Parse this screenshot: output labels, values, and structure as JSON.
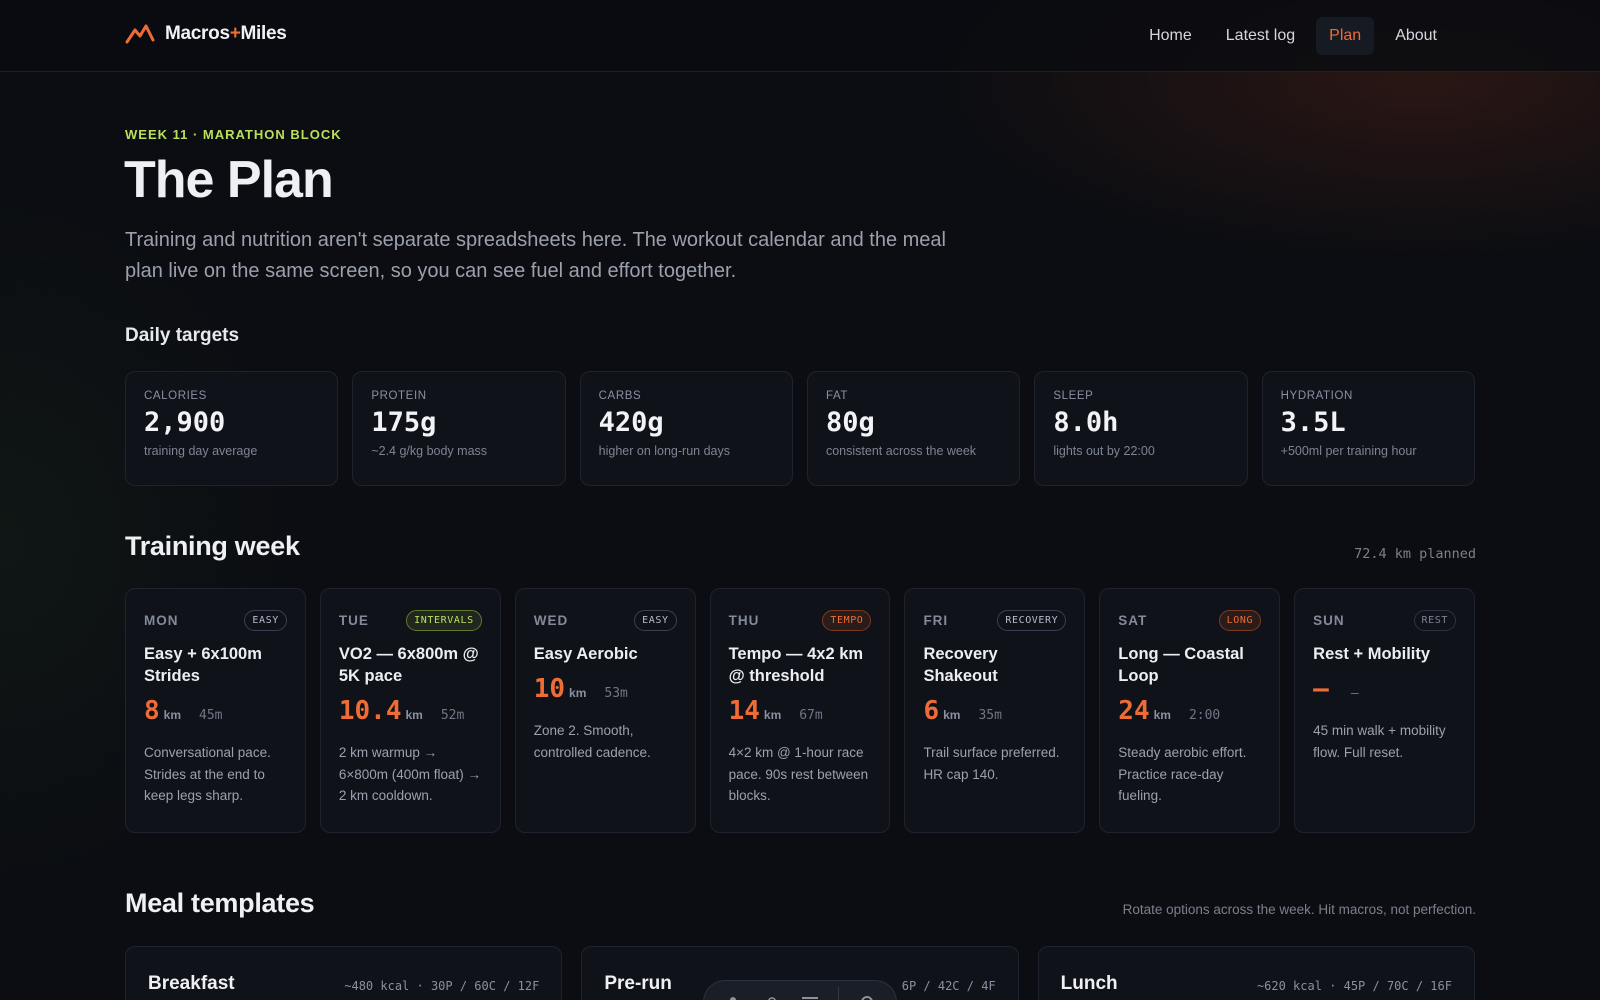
{
  "nav": {
    "brand": {
      "part1": "Macros",
      "plus": "+",
      "part2": "Miles"
    },
    "links": [
      "Home",
      "Latest log",
      "Plan",
      "About"
    ],
    "active": "Plan"
  },
  "hero": {
    "eyebrow": "WEEK 11 · MARATHON BLOCK",
    "title": "The Plan",
    "lead": "Training and nutrition aren't separate spreadsheets here. The workout calendar and the meal plan live on the same screen, so you can see fuel and effort together."
  },
  "targets": {
    "heading": "Daily targets",
    "items": [
      {
        "label": "CALORIES",
        "value": "2,900",
        "note": "training day average"
      },
      {
        "label": "PROTEIN",
        "value": "175g",
        "note": "~2.4 g/kg body mass"
      },
      {
        "label": "CARBS",
        "value": "420g",
        "note": "higher on long-run days"
      },
      {
        "label": "FAT",
        "value": "80g",
        "note": "consistent across the week"
      },
      {
        "label": "SLEEP",
        "value": "8.0h",
        "note": "lights out by 22:00"
      },
      {
        "label": "HYDRATION",
        "value": "3.5L",
        "note": "+500ml per training hour"
      }
    ]
  },
  "training": {
    "heading": "Training week",
    "planned": "72.4 km planned",
    "days": [
      {
        "day": "MON",
        "badge": "EASY",
        "badge_type": "easy",
        "title": "Easy + 6x100m Strides",
        "km": "8",
        "unit": "km",
        "duration": "45m",
        "desc": "Conversational pace. Strides at the end to keep legs sharp."
      },
      {
        "day": "TUE",
        "badge": "INTERVALS",
        "badge_type": "intervals",
        "title": "VO2 — 6x800m @ 5K pace",
        "km": "10.4",
        "unit": "km",
        "duration": "52m",
        "desc": "2 km warmup → 6×800m (400m float) → 2 km cooldown."
      },
      {
        "day": "WED",
        "badge": "EASY",
        "badge_type": "easy",
        "title": "Easy Aerobic",
        "km": "10",
        "unit": "km",
        "duration": "53m",
        "desc": "Zone 2. Smooth, controlled cadence."
      },
      {
        "day": "THU",
        "badge": "TEMPO",
        "badge_type": "tempo",
        "title": "Tempo — 4x2 km @ threshold",
        "km": "14",
        "unit": "km",
        "duration": "67m",
        "desc": "4×2 km @ 1-hour race pace. 90s rest between blocks."
      },
      {
        "day": "FRI",
        "badge": "RECOVERY",
        "badge_type": "easy",
        "title": "Recovery Shakeout",
        "km": "6",
        "unit": "km",
        "duration": "35m",
        "desc": "Trail surface preferred. HR cap 140."
      },
      {
        "day": "SAT",
        "badge": "LONG",
        "badge_type": "long",
        "title": "Long — Coastal Loop",
        "km": "24",
        "unit": "km",
        "duration": "2:00",
        "desc": "Steady aerobic effort. Practice race-day fueling."
      },
      {
        "day": "SUN",
        "badge": "REST",
        "badge_type": "rest",
        "title": "Rest + Mobility",
        "km": "—",
        "unit": "",
        "duration": "–",
        "desc": "45 min walk + mobility flow. Full reset."
      }
    ]
  },
  "meals": {
    "heading": "Meal templates",
    "note": "Rotate options across the week. Hit macros, not perfection.",
    "items": [
      {
        "name": "Breakfast",
        "stats": "~480 kcal · 30P / 60C / 12F"
      },
      {
        "name": "Pre-run",
        "stats": "6P / 42C / 4F"
      },
      {
        "name": "Lunch",
        "stats": "~620 kcal · 45P / 70C / 16F"
      }
    ]
  },
  "colors": {
    "accent": "#ee6c35",
    "eyebrow": "#b9e05b",
    "background": "#0b0d12"
  },
  "toolbar": {
    "icons": [
      "user-icon",
      "bug-icon",
      "menu-icon",
      "settings-icon"
    ]
  }
}
